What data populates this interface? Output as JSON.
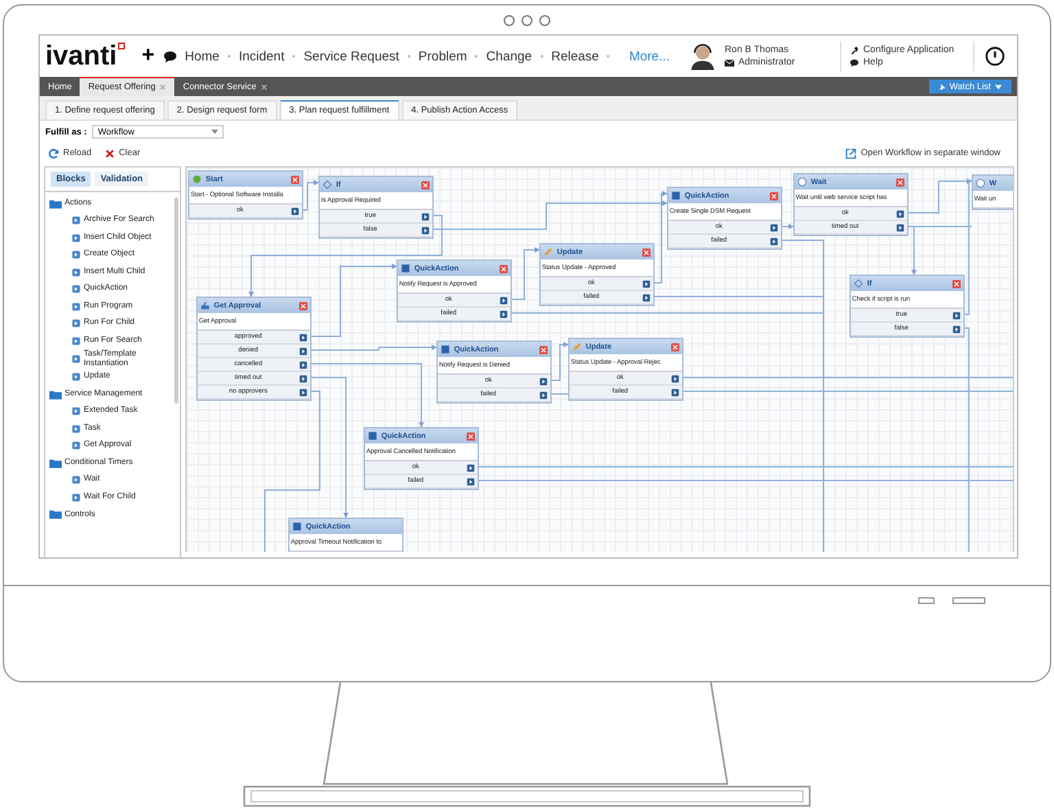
{
  "header": {
    "logo": "ivanti",
    "add": "+",
    "nav": [
      "Home",
      "Incident",
      "Service Request",
      "Problem",
      "Change",
      "Release"
    ],
    "more": "More...",
    "user": {
      "name": "Ron B Thomas",
      "role": "Administrator"
    },
    "links": [
      "Configure Application",
      "Help"
    ]
  },
  "tabs": [
    {
      "label": "Home",
      "selected": false,
      "closable": false
    },
    {
      "label": "Request Offering",
      "selected": true,
      "closable": true
    },
    {
      "label": "Connector Service",
      "selected": false,
      "closable": true
    }
  ],
  "watch_list": "Watch List",
  "steps": [
    {
      "label": "1. Define request offering",
      "selected": false
    },
    {
      "label": "2. Design request form",
      "selected": false
    },
    {
      "label": "3. Plan request fulfillment",
      "selected": true
    },
    {
      "label": "4. Publish Action Access",
      "selected": false
    }
  ],
  "fulfill": {
    "label": "Fulfill as :",
    "value": "Workflow"
  },
  "toolbar": {
    "reload": "Reload",
    "clear": "Clear",
    "open_link": "Open Workflow in separate window"
  },
  "sidebar": {
    "tabs": [
      {
        "label": "Blocks",
        "selected": true
      },
      {
        "label": "Validation",
        "selected": false
      }
    ],
    "groups": [
      {
        "label": "Actions",
        "children": [
          "Archive For Search",
          "Insert Child Object",
          "Create Object",
          "Insert Multi Child",
          "QuickAction",
          "Run Program",
          "Run For Child",
          "Run For Search",
          "Task/Template Instantiation",
          "Update"
        ]
      },
      {
        "label": "Service Management",
        "children": [
          "Extended Task",
          "Task",
          "Get Approval"
        ]
      },
      {
        "label": "Conditional Timers",
        "children": [
          "Wait",
          "Wait For Child"
        ]
      },
      {
        "label": "Controls"
      }
    ]
  },
  "nodes": [
    {
      "kind": "start",
      "title": "Start",
      "description": "Start - Optional Software Installa",
      "ports": [
        "ok"
      ]
    },
    {
      "kind": "if",
      "title": "If",
      "description": "Is Approval Required",
      "ports": [
        "true",
        "false"
      ]
    },
    {
      "kind": "quickaction",
      "title": "QuickAction",
      "description": "Notify Request is Approved",
      "ports": [
        "ok",
        "failed"
      ]
    },
    {
      "kind": "approval",
      "title": "Get Approval",
      "description": "Get Approval",
      "ports": [
        "approved",
        "denied",
        "cancelled",
        "timed out",
        "no approvers"
      ]
    },
    {
      "kind": "update",
      "title": "Update",
      "description": "Status Update - Approved",
      "ports": [
        "ok",
        "failed"
      ]
    },
    {
      "kind": "quickaction",
      "title": "QuickAction",
      "description": "Create Single DSM Request",
      "ports": [
        "ok",
        "failed"
      ]
    },
    {
      "kind": "wait",
      "title": "Wait",
      "description": "Wait until web service script has",
      "ports": [
        "ok",
        "timed out"
      ]
    },
    {
      "kind": "wait",
      "title": "W",
      "description": "Wait un"
    },
    {
      "kind": "if",
      "title": "If",
      "description": "Check if script is run",
      "ports": [
        "true",
        "false"
      ]
    },
    {
      "kind": "quickaction",
      "title": "QuickAction",
      "description": "Notify Request is Denied",
      "ports": [
        "ok",
        "failed"
      ]
    },
    {
      "kind": "update",
      "title": "Update",
      "description": "Status Update - Approval Rejec",
      "ports": [
        "ok",
        "failed"
      ]
    },
    {
      "kind": "quickaction",
      "title": "QuickAction",
      "description": "Approval Cancelled Notification",
      "ports": [
        "ok",
        "failed"
      ]
    },
    {
      "kind": "quickaction",
      "title": "QuickAction",
      "description": "Approval Timeout Notification to"
    }
  ]
}
